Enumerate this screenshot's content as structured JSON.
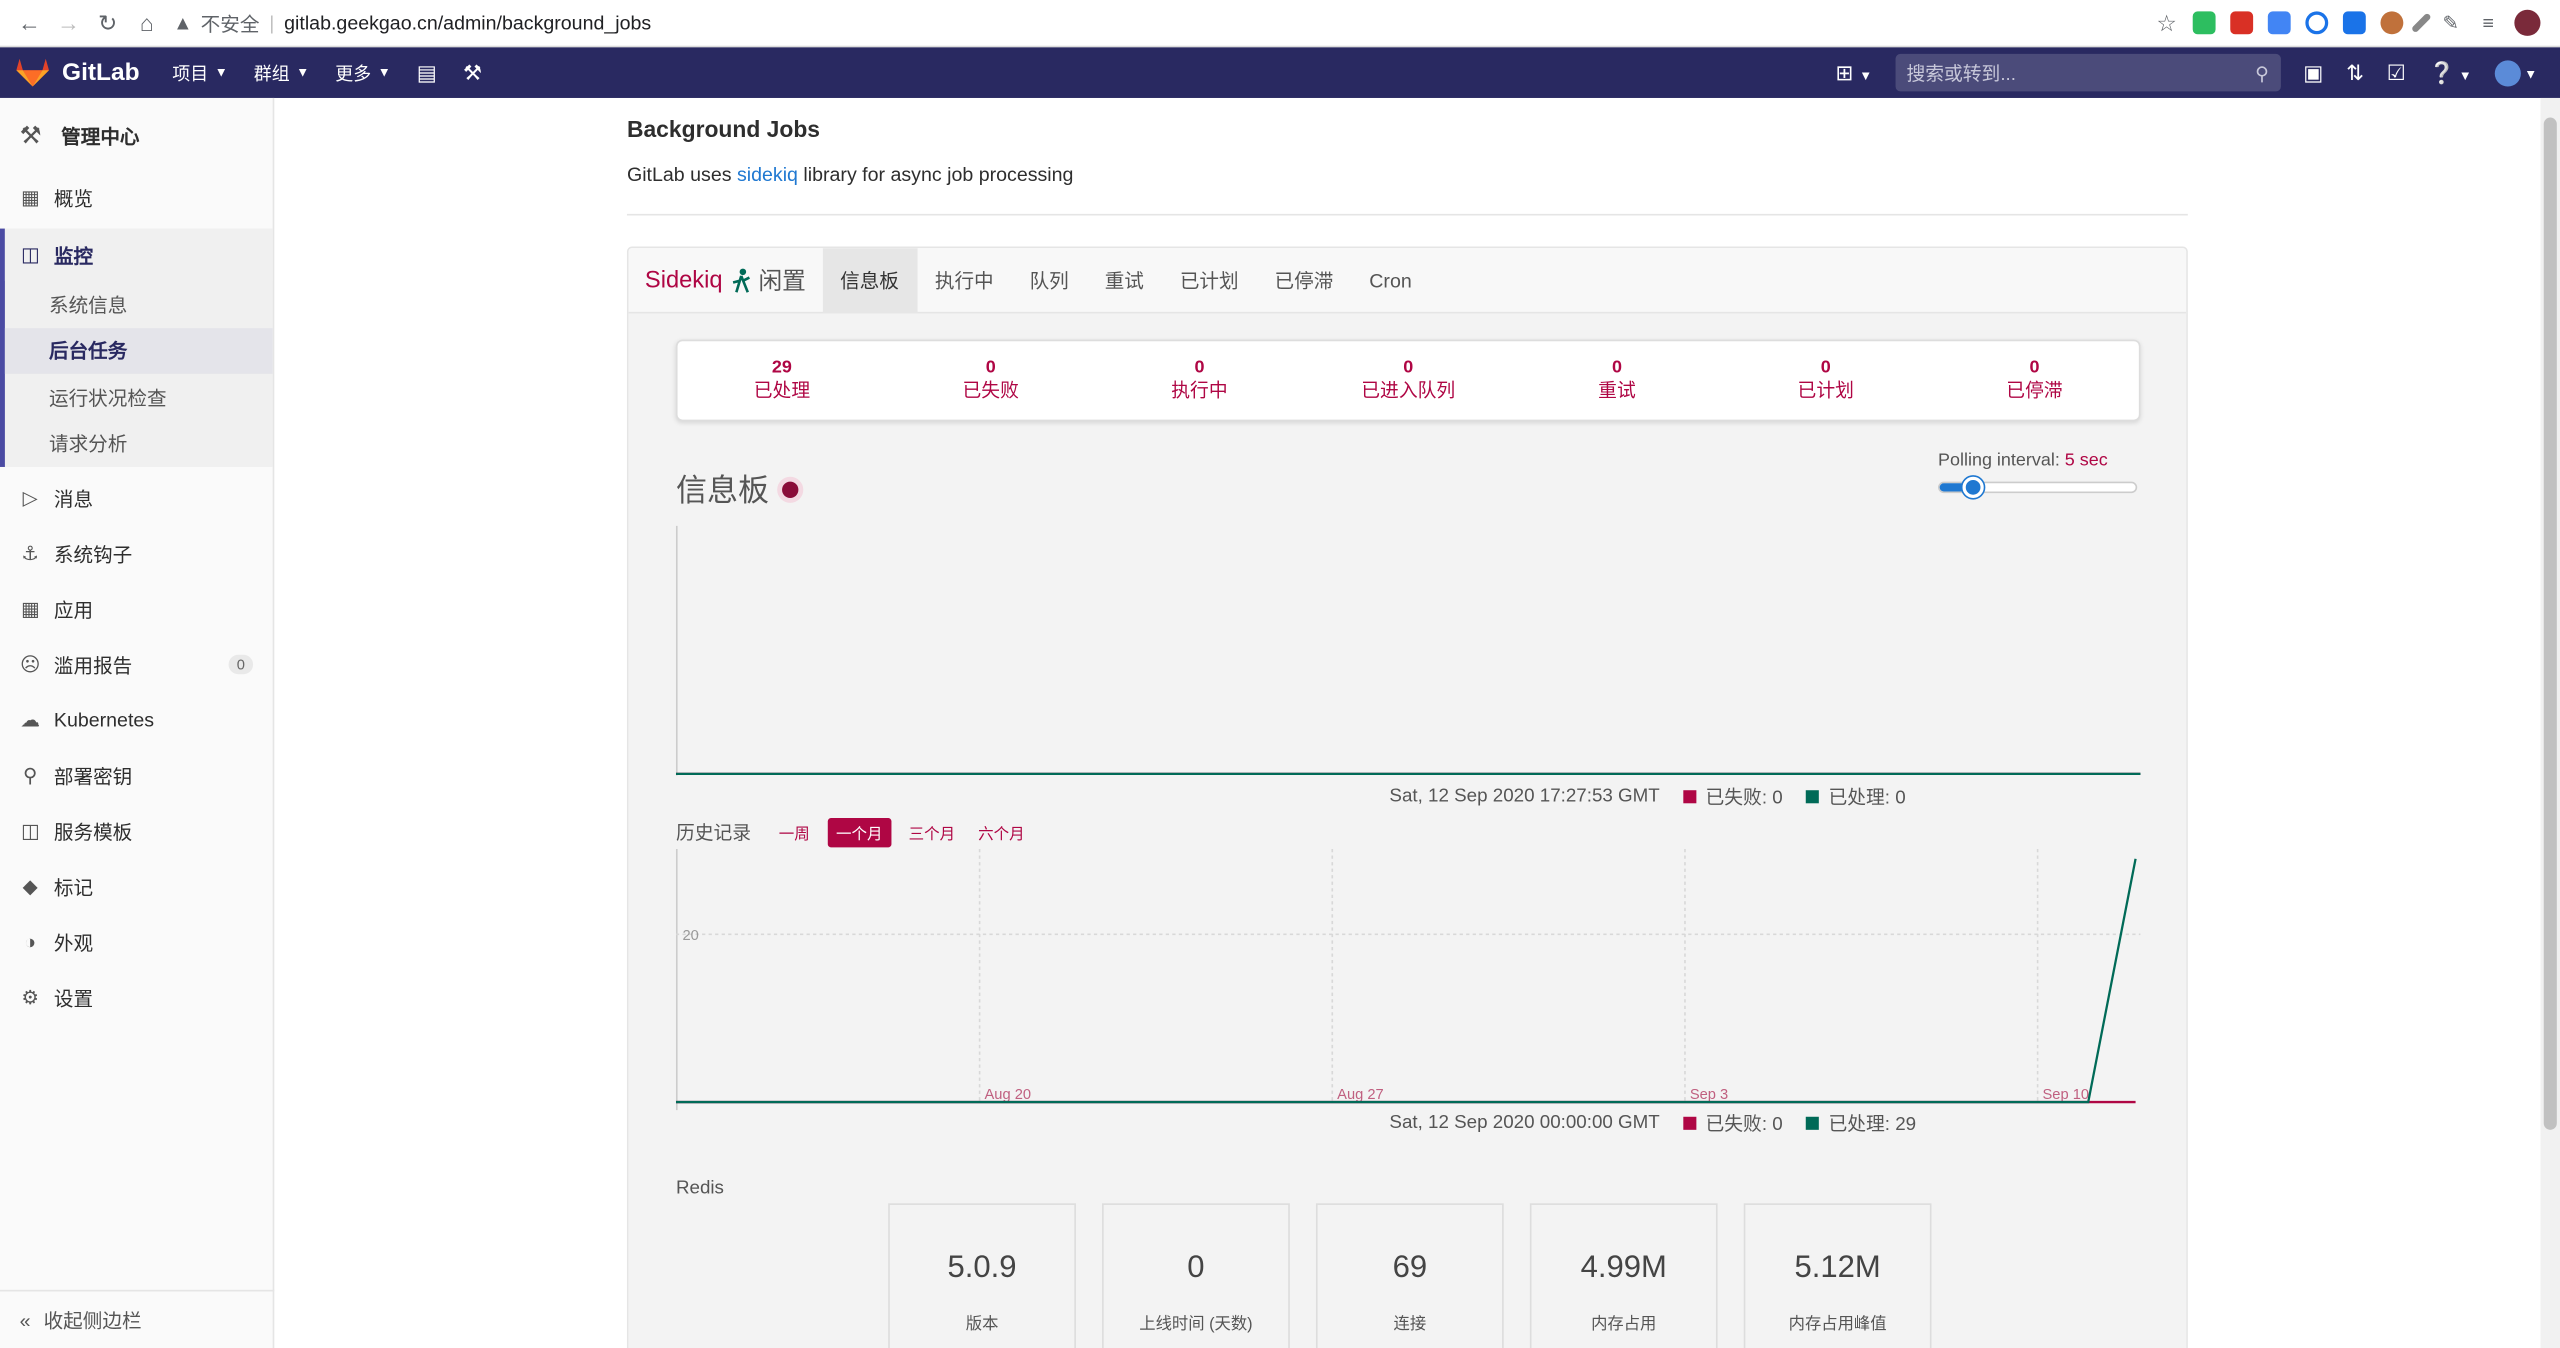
{
  "browser": {
    "insecure_label": "不安全",
    "url": "gitlab.geekgao.cn/admin/background_jobs"
  },
  "header": {
    "brand": "GitLab",
    "nav": [
      "项目",
      "群组",
      "更多"
    ],
    "search_placeholder": "搜索或转到..."
  },
  "sidebar": {
    "title": "管理中心",
    "items_top": [
      {
        "label": "概览",
        "icon": "grid-icon"
      }
    ],
    "monitor": {
      "label": "监控",
      "sub": [
        "系统信息",
        "后台任务",
        "运行状况检查",
        "请求分析"
      ],
      "active_sub": "后台任务"
    },
    "items": [
      {
        "label": "消息",
        "icon": "megaphone-icon"
      },
      {
        "label": "系统钩子",
        "icon": "hook-icon"
      },
      {
        "label": "应用",
        "icon": "apps-icon"
      },
      {
        "label": "滥用报告",
        "icon": "abuse-icon",
        "badge": "0"
      },
      {
        "label": "Kubernetes",
        "icon": "cloud-icon"
      },
      {
        "label": "部署密钥",
        "icon": "key-icon"
      },
      {
        "label": "服务模板",
        "icon": "template-icon"
      },
      {
        "label": "标记",
        "icon": "label-icon"
      },
      {
        "label": "外观",
        "icon": "palette-icon"
      },
      {
        "label": "设置",
        "icon": "gear-icon"
      }
    ],
    "collapse": "收起侧边栏"
  },
  "page": {
    "title": "Background Jobs",
    "desc_pre": "GitLab uses ",
    "desc_link": "sidekiq",
    "desc_post": " library for async job processing"
  },
  "sidekiq": {
    "brand": "Sidekiq",
    "status": "闲置",
    "tabs": [
      "信息板",
      "执行中",
      "队列",
      "重试",
      "已计划",
      "已停滞",
      "Cron"
    ],
    "active_tab": "信息板",
    "summary": [
      {
        "value": "29",
        "label": "已处理"
      },
      {
        "value": "0",
        "label": "已失败"
      },
      {
        "value": "0",
        "label": "执行中"
      },
      {
        "value": "0",
        "label": "已进入队列"
      },
      {
        "value": "0",
        "label": "重试"
      },
      {
        "value": "0",
        "label": "已计划"
      },
      {
        "value": "0",
        "label": "已停滞"
      }
    ],
    "dashboard_title": "信息板",
    "polling_label": "Polling interval: ",
    "polling_value": "5 sec",
    "polling_level": 0.12,
    "realtime": {
      "timestamp": "Sat, 12 Sep 2020 17:27:53 GMT",
      "failed_label": "已失败: 0",
      "processed_label": "已处理: 0"
    },
    "history": {
      "label": "历史记录",
      "ranges": [
        "一周",
        "一个月",
        "三个月",
        "六个月"
      ],
      "active_range": "一个月",
      "timestamp": "Sat, 12 Sep 2020 00:00:00 GMT",
      "failed_label": "已失败: 0",
      "processed_label": "已处理: 29"
    },
    "redis_title": "Redis",
    "redis": [
      {
        "value": "5.0.9",
        "label": "版本"
      },
      {
        "value": "0",
        "label": "上线时间 (天数)"
      },
      {
        "value": "69",
        "label": "连接"
      },
      {
        "value": "4.99M",
        "label": "内存占用"
      },
      {
        "value": "5.12M",
        "label": "内存占用峰值"
      }
    ]
  },
  "colors": {
    "header_bg": "#292961",
    "sidekiq_accent": "#af0644",
    "processed": "#006a57",
    "failed": "#af0644"
  },
  "chart_data": [
    {
      "type": "line",
      "series": [
        {
          "name": "已失败",
          "values": [
            0,
            0
          ]
        },
        {
          "name": "已处理",
          "values": [
            0,
            0
          ]
        }
      ]
    },
    {
      "type": "line",
      "x": [
        "Aug 14",
        "Aug 20",
        "Aug 27",
        "Sep 3",
        "Sep 10",
        "Sep 11",
        "Sep 12"
      ],
      "xticks": [
        "Aug 20",
        "Aug 27",
        "Sep 3",
        "Sep 10"
      ],
      "yticks": [
        20
      ],
      "ylim": [
        0,
        29
      ],
      "series": [
        {
          "name": "已失败",
          "values": [
            0,
            0,
            0,
            0,
            0,
            0,
            0
          ]
        },
        {
          "name": "已处理",
          "values": [
            0,
            0,
            0,
            0,
            0,
            0,
            29
          ]
        }
      ]
    }
  ]
}
